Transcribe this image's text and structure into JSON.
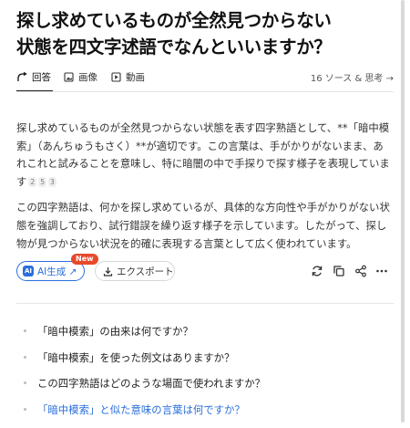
{
  "question": {
    "line1": "探し求めているものが全然見つからない",
    "line2": "状態を四文字述語でなんといいますか？"
  },
  "tabs": {
    "answer": "回答",
    "images": "画像",
    "videos": "動画",
    "sources": "16 ソース & 思考 →"
  },
  "answer": {
    "p1": "探し求めているものが全然見つからない状態を表す四字熟語として、**「暗中模索」（あんちゅうもさく）**が適切です。この言葉は、手がかりがないまま、あれこれと試みることを意味し、特に暗闇の中で手探りで探す様子を表現しています",
    "citations": [
      "2",
      "5",
      "3"
    ],
    "p2": "この四字熟語は、何かを探し求めているが、具体的な方向性や手がかりがない状態を強調しており、試行錯誤を繰り返す様子を示しています。したがって、探し物が見つからない状況を的確に表現する言葉として広く使われています。"
  },
  "actions": {
    "ai_icon": "AI",
    "ai_label": "AI生成 ↗",
    "new_badge": "New",
    "export_label": "エクスポート"
  },
  "related": [
    "「暗中模索」の由来は何ですか？",
    "「暗中模索」を使った例文はありますか？",
    "この四字熟語はどのような場面で使われますか？",
    "「暗中模索」と似た意味の言葉は何ですか？"
  ],
  "colors": {
    "accent": "#2a6fdb",
    "badge": "#e8492b"
  }
}
